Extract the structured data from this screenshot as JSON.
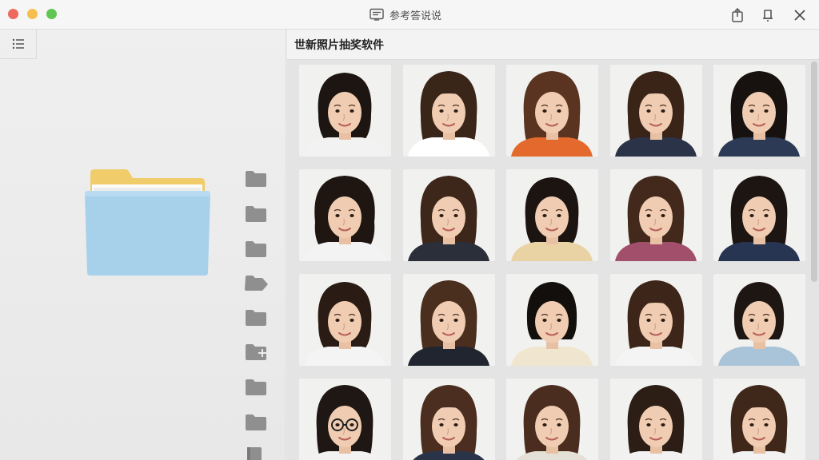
{
  "window": {
    "title": "参考答说说",
    "title_icon": "document-icon",
    "controls": [
      "share-icon",
      "bell-icon",
      "close-icon"
    ]
  },
  "sidebar": {
    "toggle_icon": "list-icon",
    "big_folder_icon": "folder-open-icon",
    "folder_icons": [
      "folder-icon",
      "folder-icon",
      "folder-icon",
      "folder-tag-icon",
      "folder-icon",
      "folder-add-icon",
      "folder-icon",
      "folder-icon",
      "book-icon"
    ]
  },
  "main": {
    "title": "世新照片抽奖软件"
  },
  "photos": [
    {
      "hair": "#1c1511",
      "shirt": "#f2f2f2",
      "style": "short"
    },
    {
      "hair": "#3a2519",
      "shirt": "#ffffff",
      "style": "bangs"
    },
    {
      "hair": "#5a3420",
      "shirt": "#e36a2c",
      "style": "long"
    },
    {
      "hair": "#3a2418",
      "shirt": "#2a3348",
      "style": "bangs"
    },
    {
      "hair": "#17120f",
      "shirt": "#2c3a55",
      "style": "long"
    },
    {
      "hair": "#1f1611",
      "shirt": "#f3f3f3",
      "style": "curly"
    },
    {
      "hair": "#3d271a",
      "shirt": "#2a2f3a",
      "style": "long"
    },
    {
      "hair": "#1c1410",
      "shirt": "#e9d3a4",
      "style": "short"
    },
    {
      "hair": "#43291b",
      "shirt": "#a24f6b",
      "style": "long"
    },
    {
      "hair": "#1d1511",
      "shirt": "#273552",
      "style": "long"
    },
    {
      "hair": "#2a1c14",
      "shirt": "#f4f4f4",
      "style": "short"
    },
    {
      "hair": "#4a2e1e",
      "shirt": "#202530",
      "style": "long"
    },
    {
      "hair": "#120f0d",
      "shirt": "#f0e6cf",
      "style": "bob"
    },
    {
      "hair": "#3d2619",
      "shirt": "#f4f4f4",
      "style": "bangs"
    },
    {
      "hair": "#1e1612",
      "shirt": "#a9c3d8",
      "style": "bob"
    },
    {
      "hair": "#1f1713",
      "shirt": "#f2f2f2",
      "style": "glasses"
    },
    {
      "hair": "#4b2e1f",
      "shirt": "#2a3448",
      "style": "bangs"
    },
    {
      "hair": "#4a2d1e",
      "shirt": "#e5e0d6",
      "style": "long"
    },
    {
      "hair": "#2c1d15",
      "shirt": "#f2f2f2",
      "style": "long"
    },
    {
      "hair": "#3f271a",
      "shirt": "#f2f2f2",
      "style": "bangs"
    }
  ]
}
